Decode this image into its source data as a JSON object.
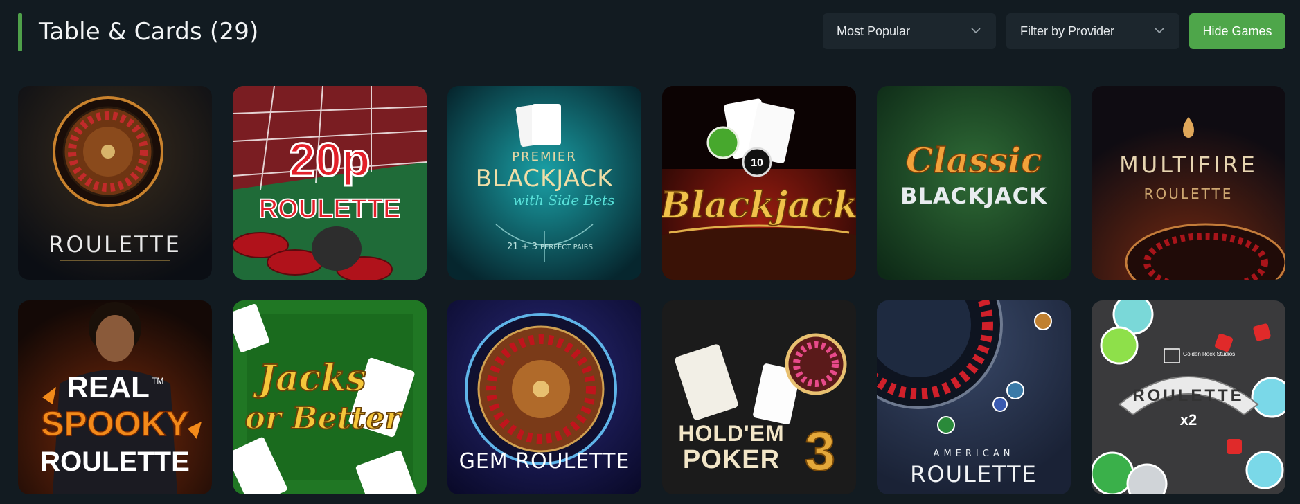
{
  "header": {
    "title": "Table & Cards (29)",
    "sort": {
      "selected": "Most Popular"
    },
    "provider": {
      "selected": "Filter by Provider"
    },
    "hide_button": "Hide Games"
  },
  "colors": {
    "background": "#121b21",
    "accent": "#4fa04a",
    "dropdown_bg": "#1c262d",
    "button_green": "#4ea64a"
  },
  "games": [
    {
      "line1": "ROULETTE"
    },
    {
      "line1": "20p",
      "line2": "ROULETTE"
    },
    {
      "line1": "PREMIER",
      "line2": "BLACKJACK",
      "line3": "with Side Bets",
      "line4": "21 + 3",
      "line5": "PERFECT PAIRS"
    },
    {
      "line1": "Blackjack",
      "chip": "10"
    },
    {
      "line1": "Classic",
      "line2": "BLACKJACK"
    },
    {
      "line1": "MULTIFIRE",
      "line2": "ROULETTE"
    },
    {
      "line1": "REAL",
      "line2": "SPOOKY",
      "line3": "ROULETTE",
      "tm": "TM"
    },
    {
      "line1": "Jacks",
      "line2": "or Better"
    },
    {
      "line1": "GEM ROULETTE"
    },
    {
      "line1": "HOLD'EM",
      "line2": "POKER",
      "line3": "3"
    },
    {
      "line1": "AMERICAN",
      "line2": "ROULETTE"
    },
    {
      "line1": "ROULETTE",
      "line2": "x2",
      "line3": "Golden Rock Studios"
    }
  ]
}
